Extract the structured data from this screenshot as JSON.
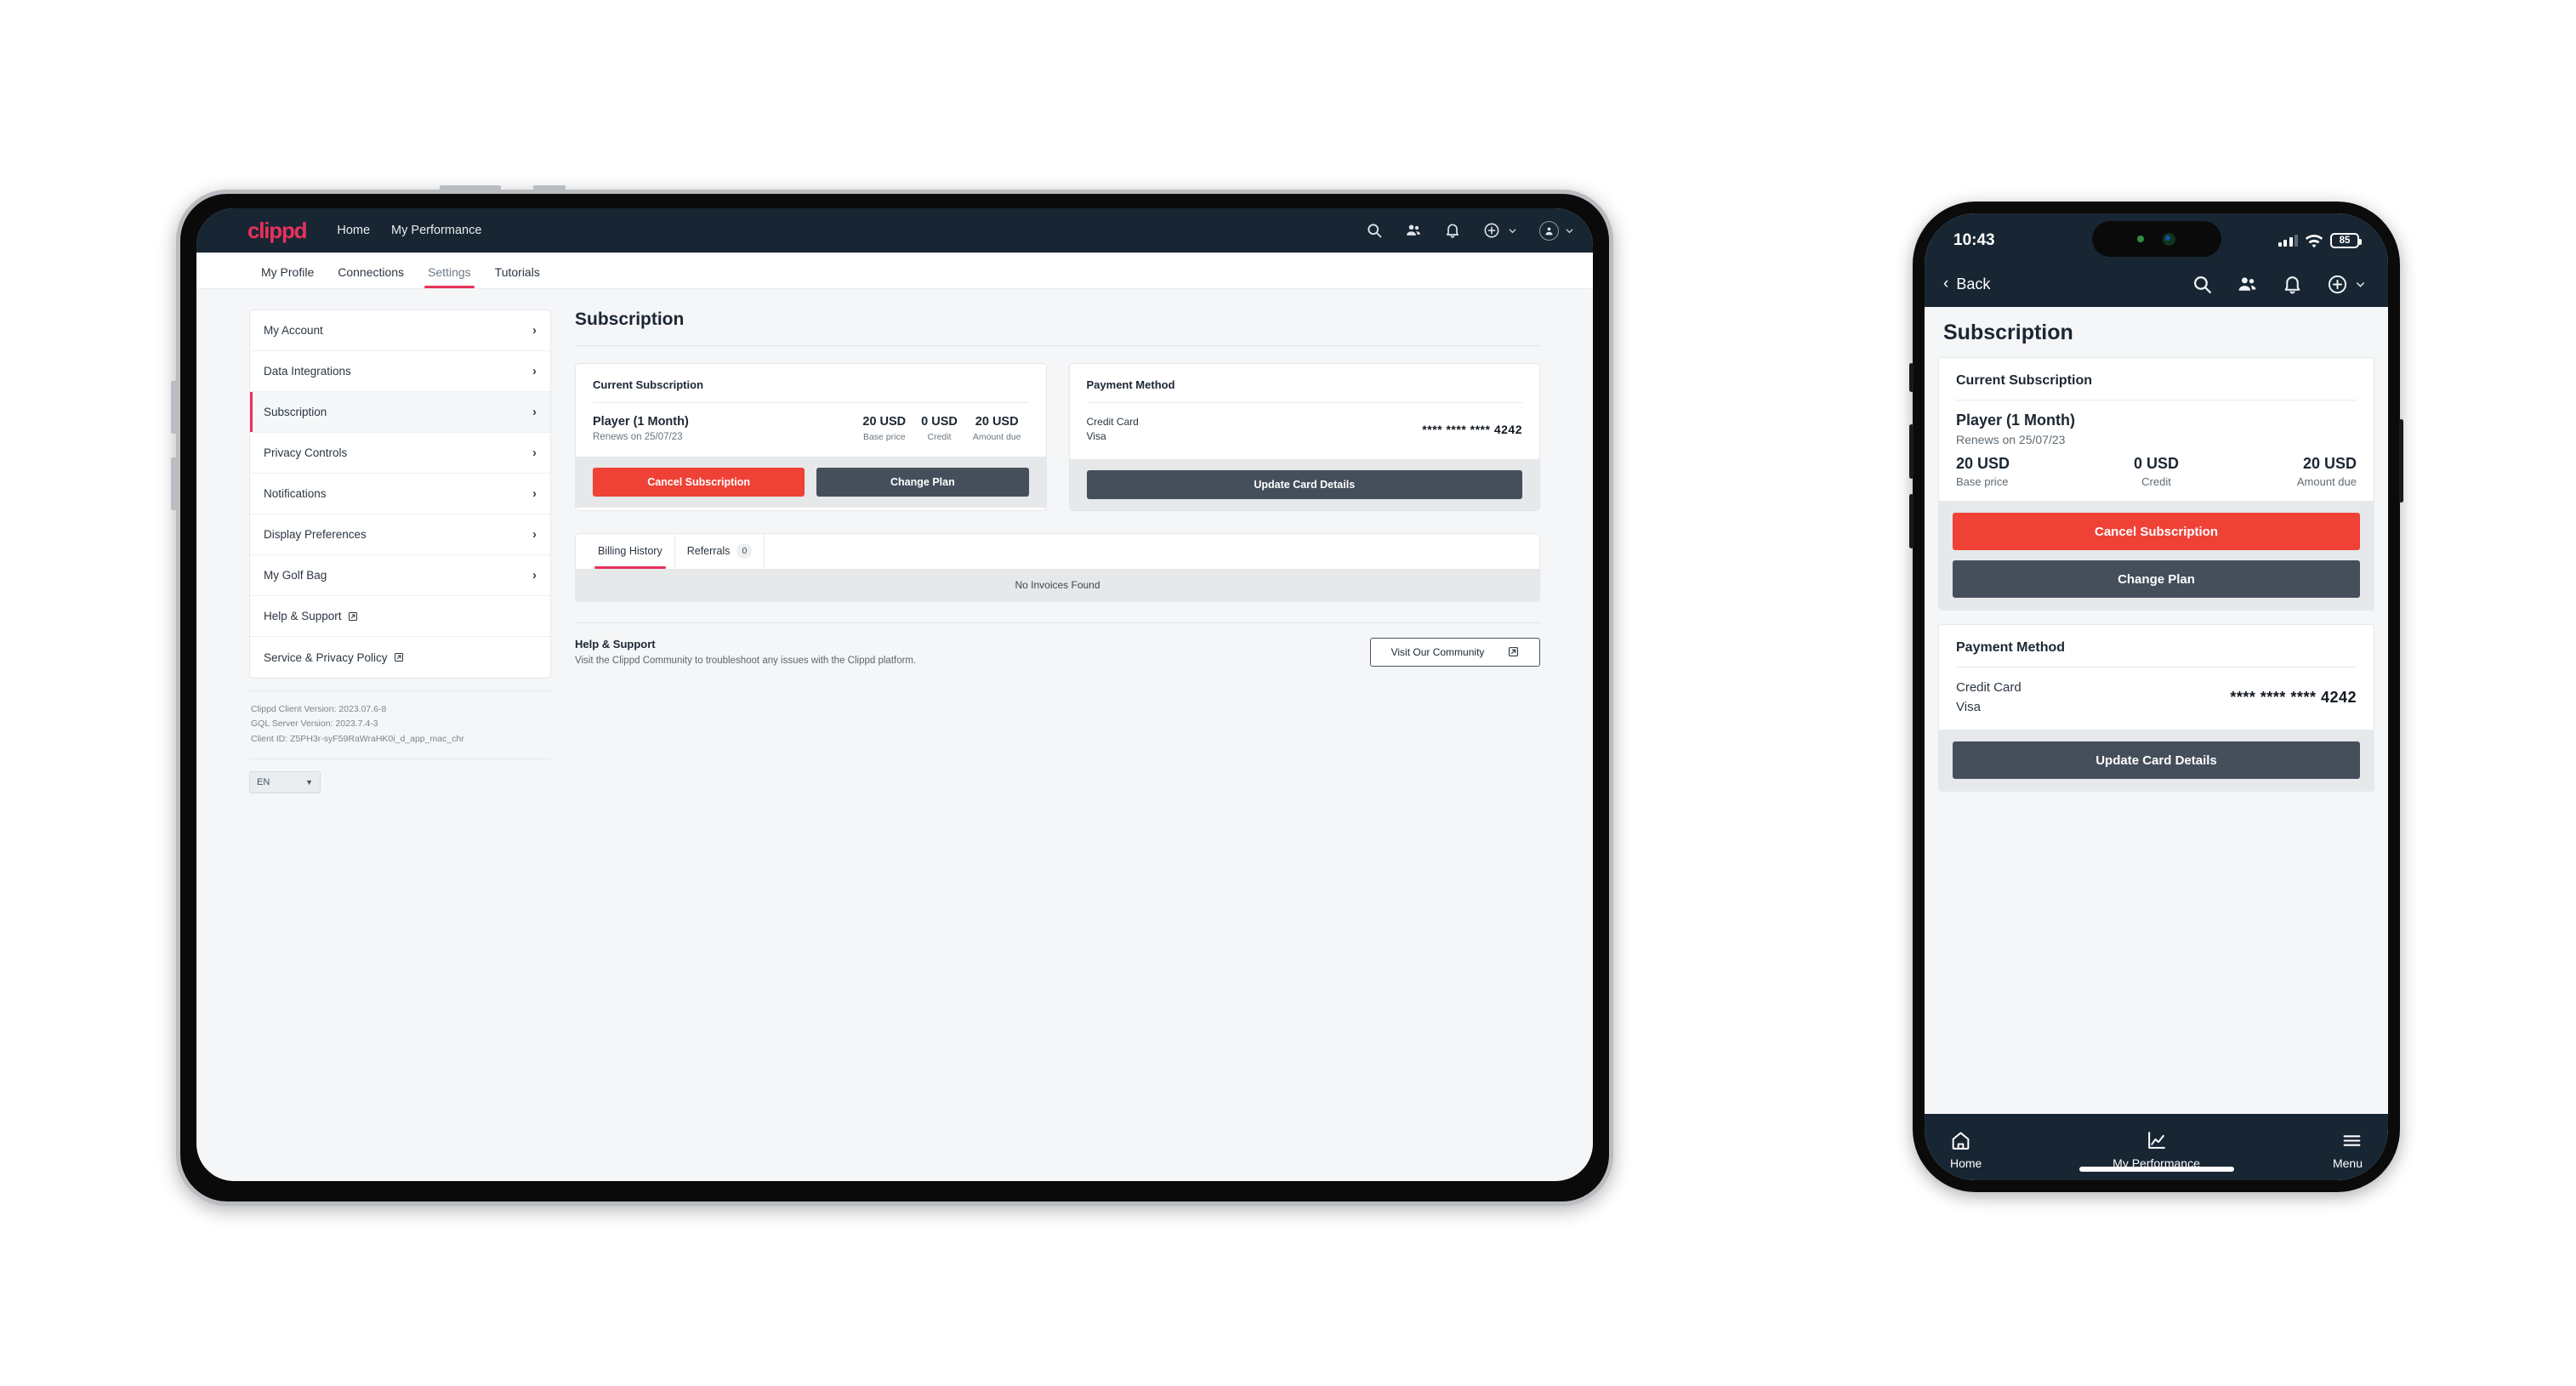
{
  "brand": {
    "name": "clippd",
    "accent": "#e8315b"
  },
  "tablet": {
    "topnav": {
      "links": [
        "Home",
        "My Performance"
      ],
      "icons": [
        "search-icon",
        "people-icon",
        "bell-icon",
        "plus-circle-icon",
        "avatar-icon"
      ]
    },
    "subtabs": [
      {
        "label": "My Profile",
        "active": false
      },
      {
        "label": "Connections",
        "active": false
      },
      {
        "label": "Settings",
        "active": true
      },
      {
        "label": "Tutorials",
        "active": false
      }
    ],
    "sidebar": {
      "items": [
        {
          "label": "My Account",
          "selected": false,
          "external": false
        },
        {
          "label": "Data Integrations",
          "selected": false,
          "external": false
        },
        {
          "label": "Subscription",
          "selected": true,
          "external": false
        },
        {
          "label": "Privacy Controls",
          "selected": false,
          "external": false
        },
        {
          "label": "Notifications",
          "selected": false,
          "external": false
        },
        {
          "label": "Display Preferences",
          "selected": false,
          "external": false
        },
        {
          "label": "My Golf Bag",
          "selected": false,
          "external": false
        },
        {
          "label": "Help & Support",
          "selected": false,
          "external": true
        },
        {
          "label": "Service & Privacy Policy",
          "selected": false,
          "external": true
        }
      ],
      "version": {
        "client": "Clippd Client Version: 2023.07.6-8",
        "server": "GQL Server Version: 2023.7.4-3",
        "client_id": "Client ID: Z5PH3r-syF59RaWraHK0i_d_app_mac_chr"
      },
      "language": "EN"
    },
    "main": {
      "page_title": "Subscription",
      "current_subscription": {
        "heading": "Current Subscription",
        "plan": "Player (1 Month)",
        "renews": "Renews on 25/07/23",
        "prices": [
          {
            "amount": "20 USD",
            "label": "Base price"
          },
          {
            "amount": "0 USD",
            "label": "Credit"
          },
          {
            "amount": "20 USD",
            "label": "Amount due"
          }
        ],
        "cancel_label": "Cancel Subscription",
        "change_label": "Change Plan"
      },
      "payment_method": {
        "heading": "Payment Method",
        "type": "Credit Card",
        "brand": "Visa",
        "number": "**** **** **** 4242",
        "update_label": "Update Card Details"
      },
      "billing": {
        "tabs": [
          {
            "label": "Billing History",
            "count": null,
            "active": true
          },
          {
            "label": "Referrals",
            "count": "0",
            "active": false
          }
        ],
        "empty": "No Invoices Found"
      },
      "help": {
        "title": "Help & Support",
        "description": "Visit the Clippd Community to troubleshoot any issues with the Clippd platform.",
        "button": "Visit Our Community"
      }
    }
  },
  "phone": {
    "status": {
      "time": "10:43",
      "battery": "85"
    },
    "navbar": {
      "back": "Back",
      "icons": [
        "search-icon",
        "people-icon",
        "bell-icon",
        "plus-circle-icon"
      ]
    },
    "page_title": "Subscription",
    "current_subscription": {
      "heading": "Current Subscription",
      "plan": "Player (1 Month)",
      "renews": "Renews on 25/07/23",
      "prices": [
        {
          "amount": "20 USD",
          "label": "Base price"
        },
        {
          "amount": "0 USD",
          "label": "Credit"
        },
        {
          "amount": "20 USD",
          "label": "Amount due"
        }
      ],
      "cancel_label": "Cancel Subscription",
      "change_label": "Change Plan"
    },
    "payment_method": {
      "heading": "Payment Method",
      "type": "Credit Card",
      "brand": "Visa",
      "number": "**** **** **** 4242",
      "update_label": "Update Card Details"
    },
    "tabbar": [
      {
        "label": "Home",
        "icon": "home-icon"
      },
      {
        "label": "My Performance",
        "icon": "chart-line-icon"
      },
      {
        "label": "Menu",
        "icon": "hamburger-icon"
      }
    ]
  }
}
